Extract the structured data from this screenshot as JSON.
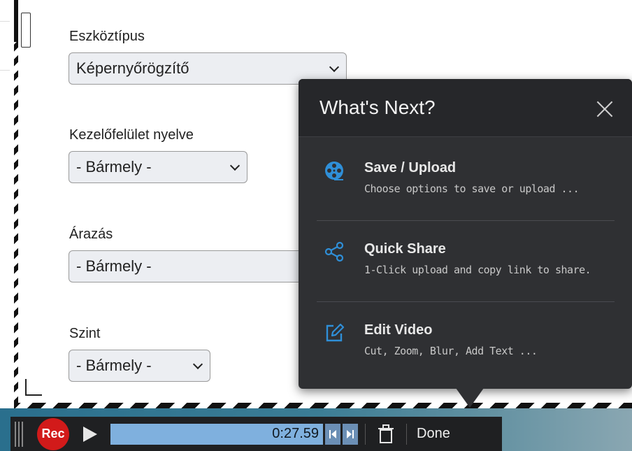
{
  "form": {
    "fields": [
      {
        "label": "Eszköztípus",
        "value": "Képernyőrögzítő"
      },
      {
        "label": "Kezelőfelület nyelve",
        "value": "- Bármely -"
      },
      {
        "label": "Árazás",
        "value": "- Bármely -"
      },
      {
        "label": "Szint",
        "value": "- Bármely -"
      }
    ]
  },
  "popup": {
    "title": "What's Next?",
    "options": [
      {
        "icon": "film-reel-icon",
        "title": "Save / Upload",
        "description": "Choose options to save or upload ..."
      },
      {
        "icon": "share-icon",
        "title": "Quick Share",
        "description": "1-Click upload and copy link to share."
      },
      {
        "icon": "edit-icon",
        "title": "Edit Video",
        "description": "Cut, Zoom, Blur, Add Text ..."
      }
    ],
    "accent_color": "#2f8fd8"
  },
  "toolbar": {
    "rec_label": "Rec",
    "time": "0:27.59",
    "done_label": "Done",
    "rec_color": "#d21a1a"
  }
}
